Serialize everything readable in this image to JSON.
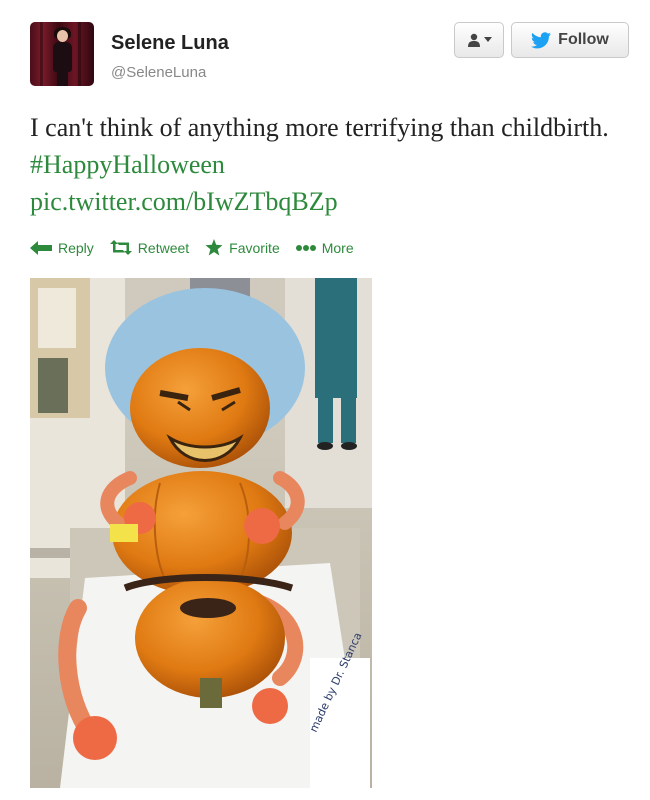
{
  "profile": {
    "name": "Selene Luna",
    "handle": "@SeleneLuna"
  },
  "buttons": {
    "follow_label": "Follow"
  },
  "tweet": {
    "text_plain": "I can't think of anything more terrifying than childbirth.",
    "hashtag": "#HappyHalloween",
    "link": "pic.twitter.com/bIwZTbqBZp"
  },
  "actions": {
    "reply": "Reply",
    "retweet": "Retweet",
    "favorite": "Favorite",
    "more": "More"
  },
  "photo": {
    "paper_text": "made by Dr. Stanca"
  },
  "colors": {
    "link_green": "#2d8a3c",
    "twitter_blue": "#1da1f2",
    "pumpkin": "#e07a12"
  },
  "icons": {
    "user": "user-dropdown-icon",
    "bird": "twitter-bird-icon",
    "reply": "reply-arrow-icon",
    "retweet": "retweet-icon",
    "favorite": "star-icon",
    "more": "more-dots-icon"
  }
}
